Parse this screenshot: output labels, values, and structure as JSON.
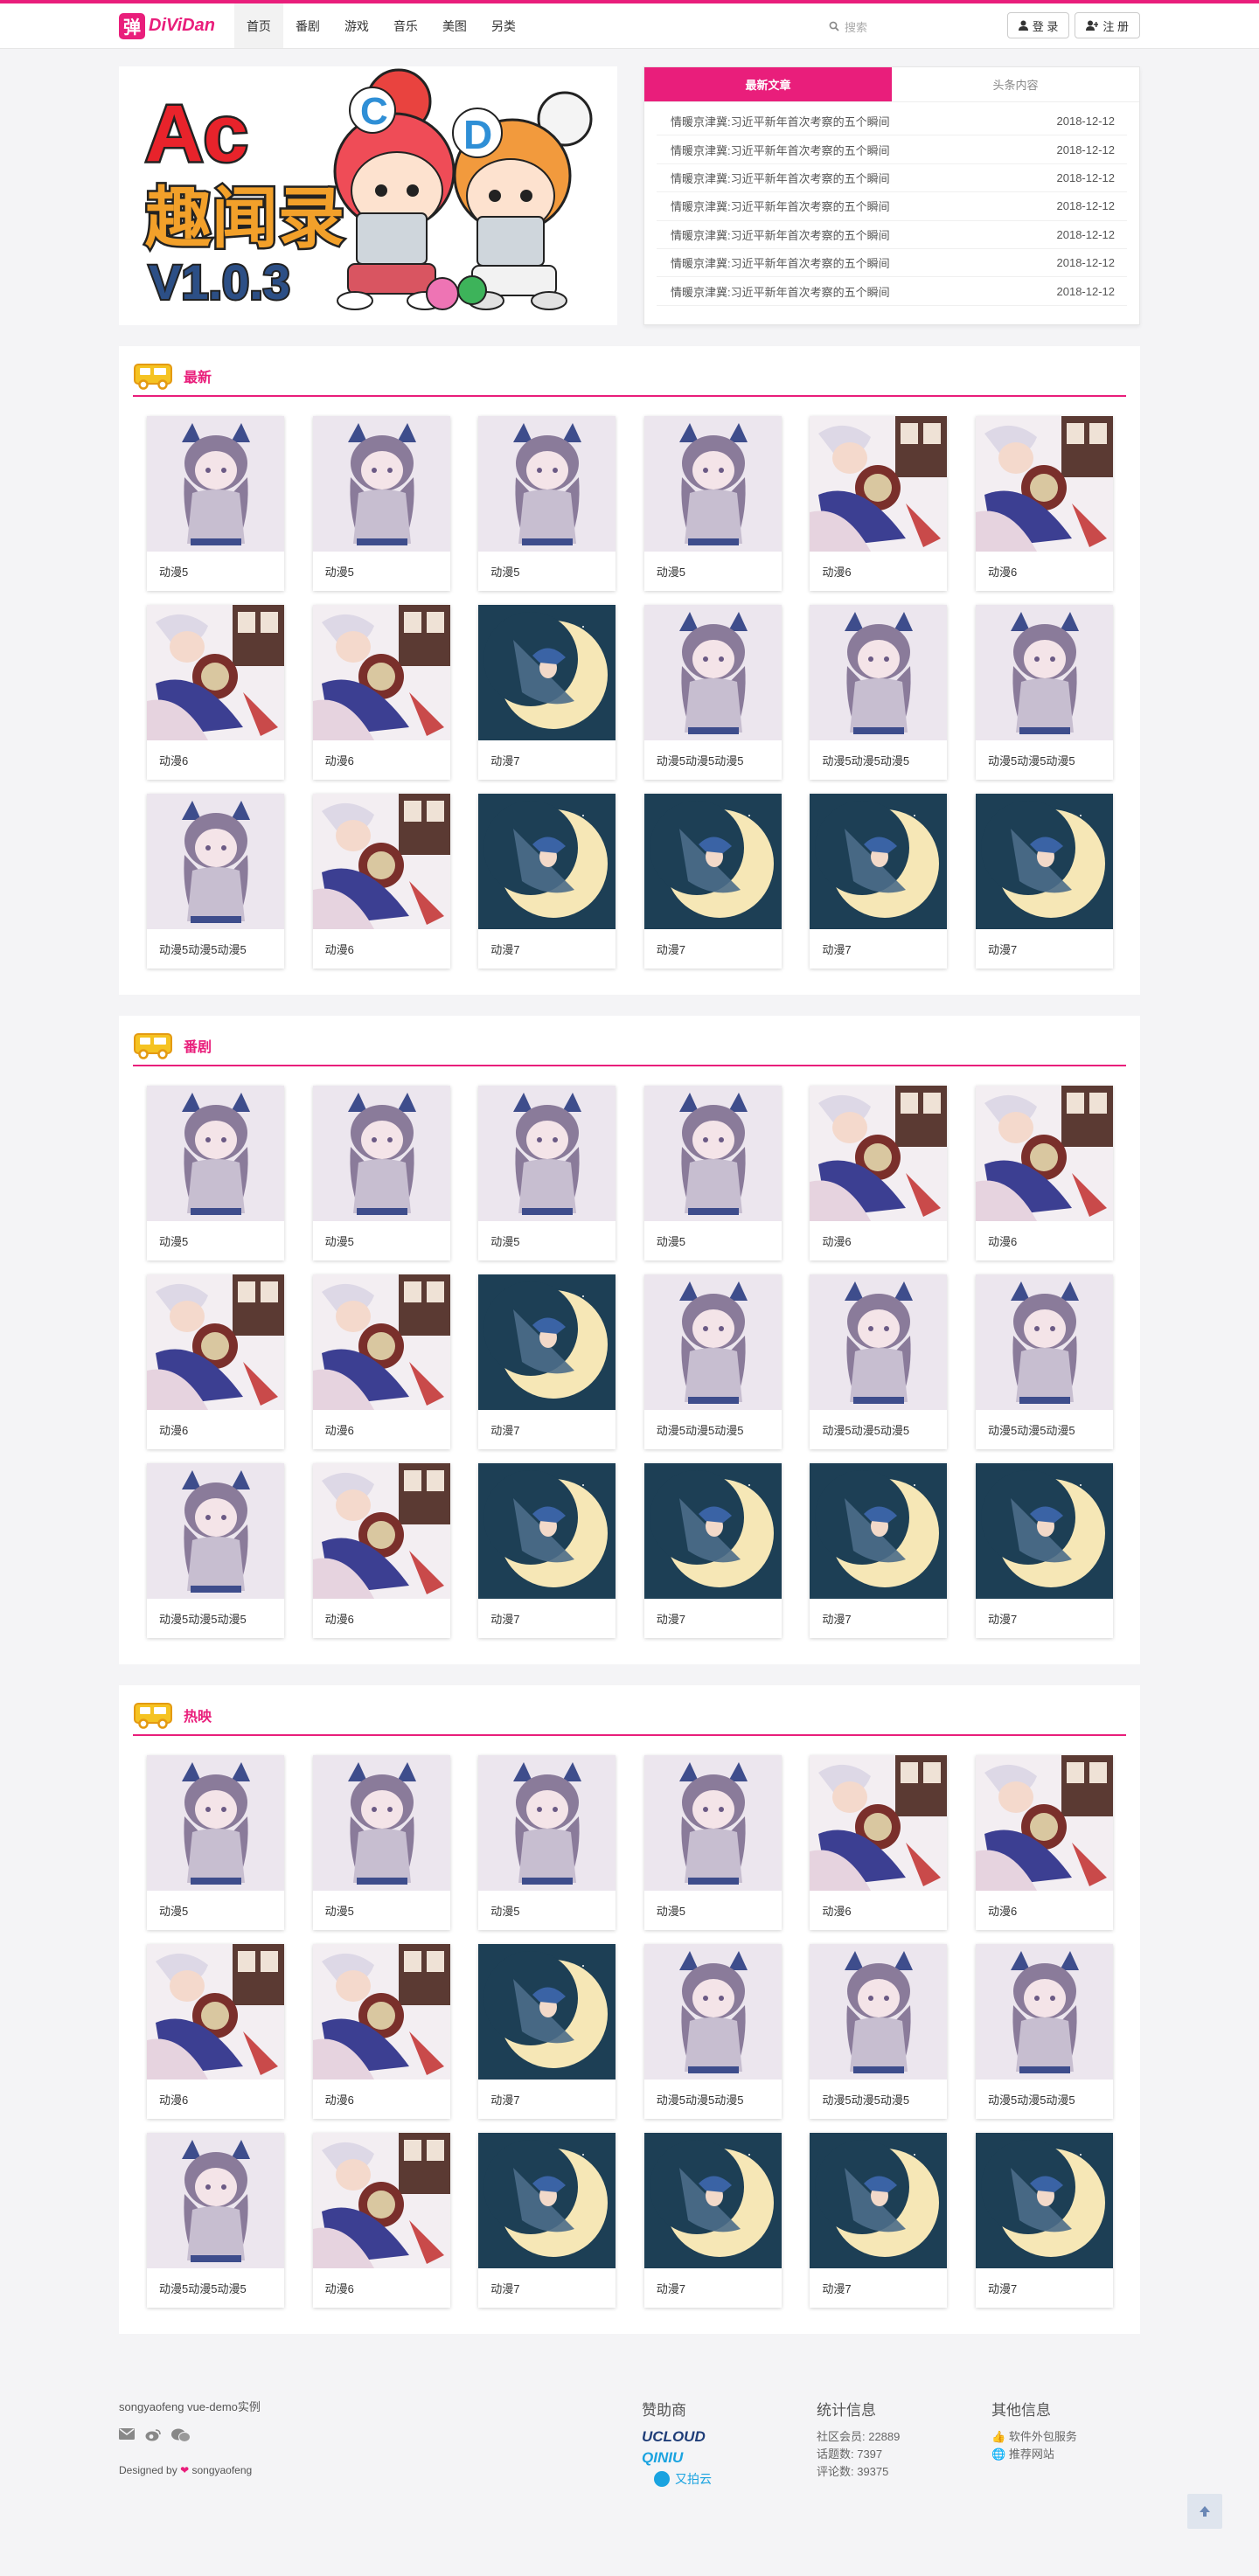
{
  "nav": {
    "logo_mark": "弹",
    "logo_text": "DiViDan",
    "menu": [
      "首页",
      "番剧",
      "游戏",
      "音乐",
      "美图",
      "另类"
    ],
    "search_placeholder": "搜索",
    "login": "登 录",
    "register": "注 册"
  },
  "banner": {
    "line1": "Ac",
    "line2": "趣闻录",
    "line3": "V1.0.3",
    "badge_c": "C",
    "badge_d": "D"
  },
  "news": {
    "tab_latest": "最新文章",
    "tab_headline": "头条内容",
    "items": [
      {
        "title": "情暖京津冀:习近平新年首次考察的五个瞬间",
        "date": "2018-12-12"
      },
      {
        "title": "情暖京津冀:习近平新年首次考察的五个瞬间",
        "date": "2018-12-12"
      },
      {
        "title": "情暖京津冀:习近平新年首次考察的五个瞬间",
        "date": "2018-12-12"
      },
      {
        "title": "情暖京津冀:习近平新年首次考察的五个瞬间",
        "date": "2018-12-12"
      },
      {
        "title": "情暖京津冀:习近平新年首次考察的五个瞬间",
        "date": "2018-12-12"
      },
      {
        "title": "情暖京津冀:习近平新年首次考察的五个瞬间",
        "date": "2018-12-12"
      },
      {
        "title": "情暖京津冀:习近平新年首次考察的五个瞬间",
        "date": "2018-12-12"
      }
    ]
  },
  "sections": [
    {
      "title": "最新",
      "cards": [
        {
          "label": "动漫5",
          "art": "girl"
        },
        {
          "label": "动漫5",
          "art": "girl"
        },
        {
          "label": "动漫5",
          "art": "girl"
        },
        {
          "label": "动漫5",
          "art": "girl"
        },
        {
          "label": "动漫6",
          "art": "mage"
        },
        {
          "label": "动漫6",
          "art": "mage"
        },
        {
          "label": "动漫6",
          "art": "mage"
        },
        {
          "label": "动漫6",
          "art": "mage"
        },
        {
          "label": "动漫7",
          "art": "moon"
        },
        {
          "label": "动漫5动漫5动漫5",
          "art": "girl"
        },
        {
          "label": "动漫5动漫5动漫5",
          "art": "girl"
        },
        {
          "label": "动漫5动漫5动漫5",
          "art": "girl"
        },
        {
          "label": "动漫5动漫5动漫5",
          "art": "girl"
        },
        {
          "label": "动漫6",
          "art": "mage"
        },
        {
          "label": "动漫7",
          "art": "moon"
        },
        {
          "label": "动漫7",
          "art": "moon"
        },
        {
          "label": "动漫7",
          "art": "moon"
        },
        {
          "label": "动漫7",
          "art": "moon"
        }
      ]
    },
    {
      "title": "番剧",
      "cards": [
        {
          "label": "动漫5",
          "art": "girl"
        },
        {
          "label": "动漫5",
          "art": "girl"
        },
        {
          "label": "动漫5",
          "art": "girl"
        },
        {
          "label": "动漫5",
          "art": "girl"
        },
        {
          "label": "动漫6",
          "art": "mage"
        },
        {
          "label": "动漫6",
          "art": "mage"
        },
        {
          "label": "动漫6",
          "art": "mage"
        },
        {
          "label": "动漫6",
          "art": "mage"
        },
        {
          "label": "动漫7",
          "art": "moon"
        },
        {
          "label": "动漫5动漫5动漫5",
          "art": "girl"
        },
        {
          "label": "动漫5动漫5动漫5",
          "art": "girl"
        },
        {
          "label": "动漫5动漫5动漫5",
          "art": "girl"
        },
        {
          "label": "动漫5动漫5动漫5",
          "art": "girl"
        },
        {
          "label": "动漫6",
          "art": "mage"
        },
        {
          "label": "动漫7",
          "art": "moon"
        },
        {
          "label": "动漫7",
          "art": "moon"
        },
        {
          "label": "动漫7",
          "art": "moon"
        },
        {
          "label": "动漫7",
          "art": "moon"
        }
      ]
    },
    {
      "title": "热映",
      "cards": [
        {
          "label": "动漫5",
          "art": "girl"
        },
        {
          "label": "动漫5",
          "art": "girl"
        },
        {
          "label": "动漫5",
          "art": "girl"
        },
        {
          "label": "动漫5",
          "art": "girl"
        },
        {
          "label": "动漫6",
          "art": "mage"
        },
        {
          "label": "动漫6",
          "art": "mage"
        },
        {
          "label": "动漫6",
          "art": "mage"
        },
        {
          "label": "动漫6",
          "art": "mage"
        },
        {
          "label": "动漫7",
          "art": "moon"
        },
        {
          "label": "动漫5动漫5动漫5",
          "art": "girl"
        },
        {
          "label": "动漫5动漫5动漫5",
          "art": "girl"
        },
        {
          "label": "动漫5动漫5动漫5",
          "art": "girl"
        },
        {
          "label": "动漫5动漫5动漫5",
          "art": "girl"
        },
        {
          "label": "动漫6",
          "art": "mage"
        },
        {
          "label": "动漫7",
          "art": "moon"
        },
        {
          "label": "动漫7",
          "art": "moon"
        },
        {
          "label": "动漫7",
          "art": "moon"
        },
        {
          "label": "动漫7",
          "art": "moon"
        }
      ]
    }
  ],
  "footer": {
    "site": "songyaofeng vue-demo实例",
    "designed_prefix": "Designed by",
    "designed_name": "songyaofeng",
    "sponsors_title": "赞助商",
    "sponsors": [
      "UCLOUD",
      "QINIU",
      "又拍云"
    ],
    "stats_title": "统计信息",
    "stats": [
      "社区会员: 22889",
      "话题数: 7397",
      "评论数: 39375"
    ],
    "other_title": "其他信息",
    "other": [
      "软件外包服务",
      "推荐网站"
    ]
  },
  "colors": {
    "accent": "#e91e7b",
    "moon_bg": "#1d3f55",
    "girl_bg": "#ece6ee"
  }
}
